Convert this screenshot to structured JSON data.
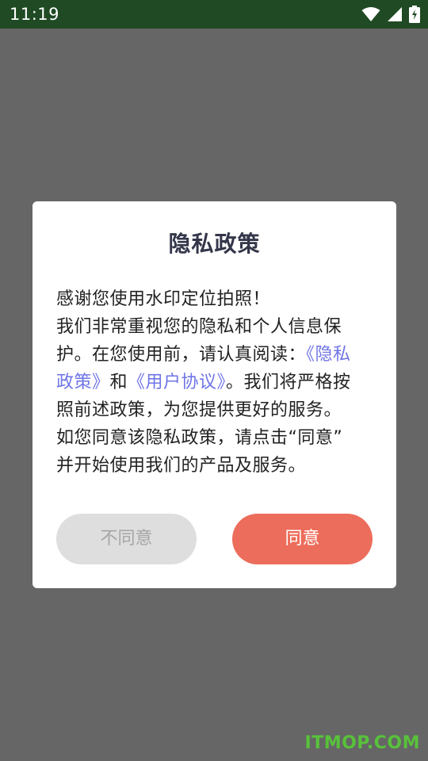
{
  "status_bar": {
    "time": "11:19",
    "icons": [
      "wifi-icon",
      "signal-icon",
      "battery-charging-icon"
    ],
    "background": "#1f4a23"
  },
  "overlay": {
    "background": "#666666"
  },
  "dialog": {
    "title": "隐私政策",
    "body": {
      "line1": "感谢您使用水印定位拍照！",
      "line2": "我们非常重视您的隐私和个人信息保",
      "line3_text": "护。在您使用前，请认真阅读：",
      "link_privacy_part1": "《隐私",
      "link_privacy_part2": "政策》",
      "line4_and": "和",
      "link_agreement": "《用户协议》",
      "line4_rest": "。我们将严格按",
      "line5": "照前述政策，为您提供更好的服务。",
      "line6": "如您同意该隐私政策，请点击“同意”",
      "line7": "并开始使用我们的产品及服务。"
    },
    "buttons": {
      "decline": "不同意",
      "agree": "同意"
    },
    "colors": {
      "link": "#6f75e6",
      "agree": "#ec6d5b",
      "decline": "#dedede"
    }
  },
  "watermark": "ITMOP.COM"
}
